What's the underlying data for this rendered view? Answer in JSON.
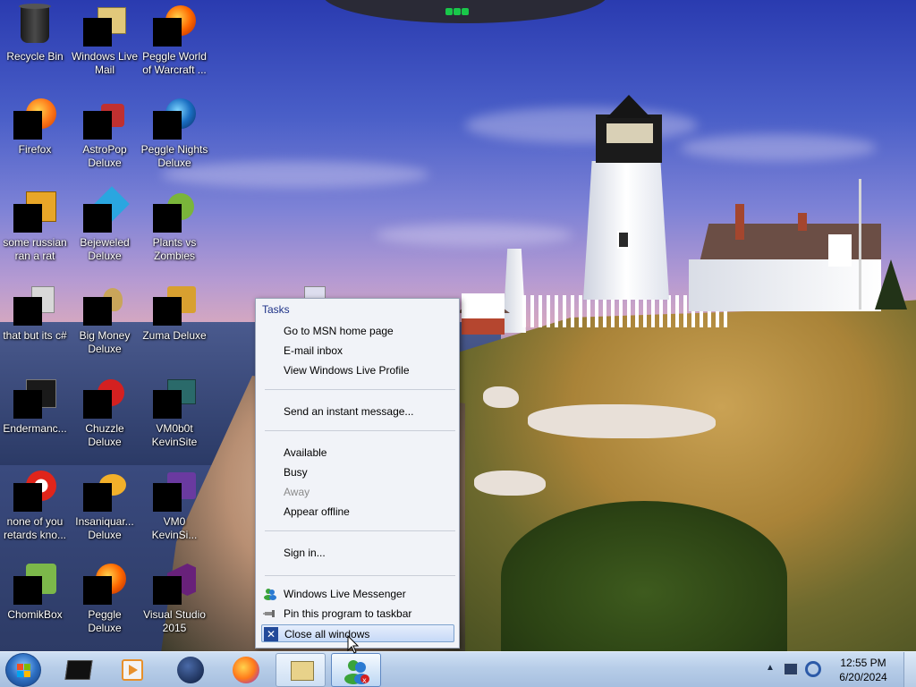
{
  "desktop": {
    "icons": [
      {
        "name": "recycle-bin",
        "label": "Recycle Bin"
      },
      {
        "name": "windows-live-mail",
        "label": "Windows Live Mail"
      },
      {
        "name": "peggle-world-of-warcraft",
        "label": "Peggle World of Warcraft ..."
      },
      {
        "name": "firefox",
        "label": "Firefox"
      },
      {
        "name": "astropop-deluxe",
        "label": "AstroPop Deluxe"
      },
      {
        "name": "peggle-nights-deluxe",
        "label": "Peggle Nights Deluxe"
      },
      {
        "name": "some-russian-ran-a-rat",
        "label": "some russian ran a rat"
      },
      {
        "name": "bejeweled-deluxe",
        "label": "Bejeweled Deluxe"
      },
      {
        "name": "plants-vs-zombies",
        "label": "Plants vs Zombies"
      },
      {
        "name": "that-but-its-csharp",
        "label": "that but its c#"
      },
      {
        "name": "big-money-deluxe",
        "label": "Big Money Deluxe"
      },
      {
        "name": "zuma-deluxe",
        "label": "Zuma Deluxe"
      },
      {
        "name": "endermanc",
        "label": "Endermanc..."
      },
      {
        "name": "chuzzle-deluxe",
        "label": "Chuzzle Deluxe"
      },
      {
        "name": "vm0b0t-kevinsite",
        "label": "VM0b0t KevinSite"
      },
      {
        "name": "none-of-you-retards",
        "label": "none of you retards kno..."
      },
      {
        "name": "insaniquarium-deluxe",
        "label": "Insaniquar... Deluxe"
      },
      {
        "name": "vm0-kevinsi",
        "label": "VM0 KevinSi..."
      },
      {
        "name": "chomikbox",
        "label": "ChomikBox"
      },
      {
        "name": "peggle-deluxe",
        "label": "Peggle Deluxe"
      },
      {
        "name": "visual-studio-2015",
        "label": "Visual Studio 2015"
      }
    ]
  },
  "jumplist": {
    "tasks_header": "Tasks",
    "tasks": [
      "Go to MSN home page",
      "E-mail inbox",
      "View Windows Live Profile"
    ],
    "messaging": [
      "Send an instant message..."
    ],
    "status": [
      {
        "label": "Available",
        "enabled": true
      },
      {
        "label": "Busy",
        "enabled": true
      },
      {
        "label": "Away",
        "enabled": false
      },
      {
        "label": "Appear offline",
        "enabled": true
      }
    ],
    "sign_in": "Sign in...",
    "program_name": "Windows Live Messenger",
    "pin_label": "Pin this program to taskbar",
    "close_label": "Close all windows"
  },
  "taskbar": {
    "buttons": [
      "start-button",
      "cmd-window",
      "media-player",
      "app-globe",
      "firefox",
      "windows-live-mail",
      "windows-live-messenger"
    ],
    "clock": {
      "time": "12:55 PM",
      "date": "6/20/2024"
    }
  },
  "colors": {
    "menu_header": "#1e3287",
    "taskbar": "#b7cde8",
    "highlight": "#c6d9f7"
  }
}
